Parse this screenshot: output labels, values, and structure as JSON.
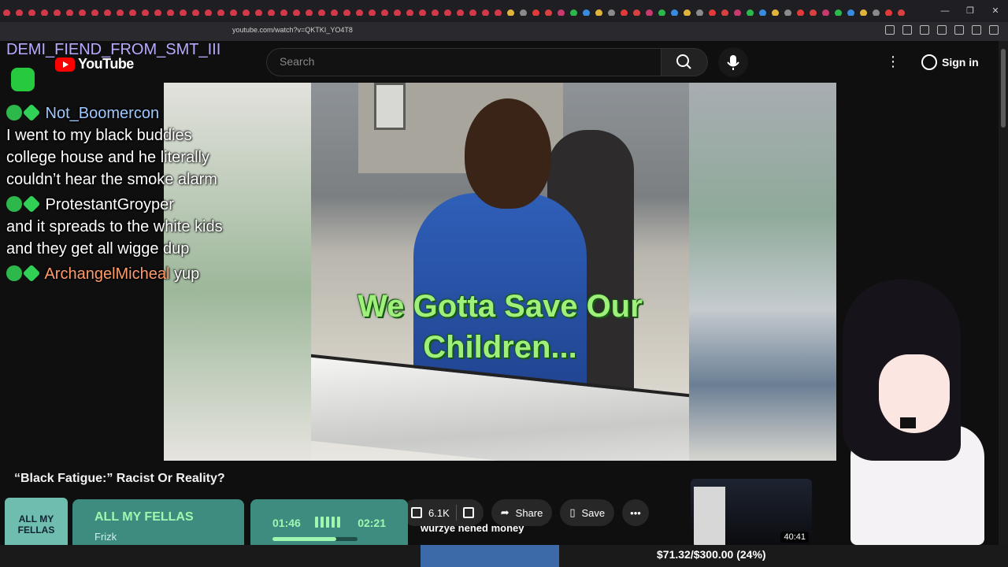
{
  "browser": {
    "url": "youtube.com/watch?v=QKTKI_YO4T8"
  },
  "youtube": {
    "search_placeholder": "Search",
    "sign_in": "Sign in",
    "video_caption_line1": "We Gotta Save Our",
    "video_caption_line2": "Children...",
    "video_title": "“Black Fatigue:” Racist Or Reality?",
    "like_count": "6.1K",
    "share_label": "Share",
    "save_label": "Save",
    "related_duration": "40:41"
  },
  "overlay": {
    "streamer_name": "DEMI_FIEND_FROM_SMT_III",
    "chat": [
      {
        "user": "Not_Boomercon",
        "user_color": "#9ec8ff",
        "text": "I went to my black buddies college house and he literally couldn’t hear the smoke alarm"
      },
      {
        "user": "ProtestantGroyper",
        "user_color": "#ffffff",
        "text": "and it spreads to the white kids and they get all wigge dup"
      },
      {
        "user": "ArchangelMicheal",
        "user_color": "#ff9a6b",
        "text": "yup"
      }
    ],
    "now_playing": {
      "album_art_text": "ALL MY FELLAS",
      "title": "ALL MY FELLAS",
      "artist": "Frizk",
      "elapsed": "01:46",
      "duration": "02:21",
      "progress": 0.75
    },
    "subcaption": "wurzye nened money",
    "donation_goal": "$71.32/$300.00 (24%)"
  }
}
